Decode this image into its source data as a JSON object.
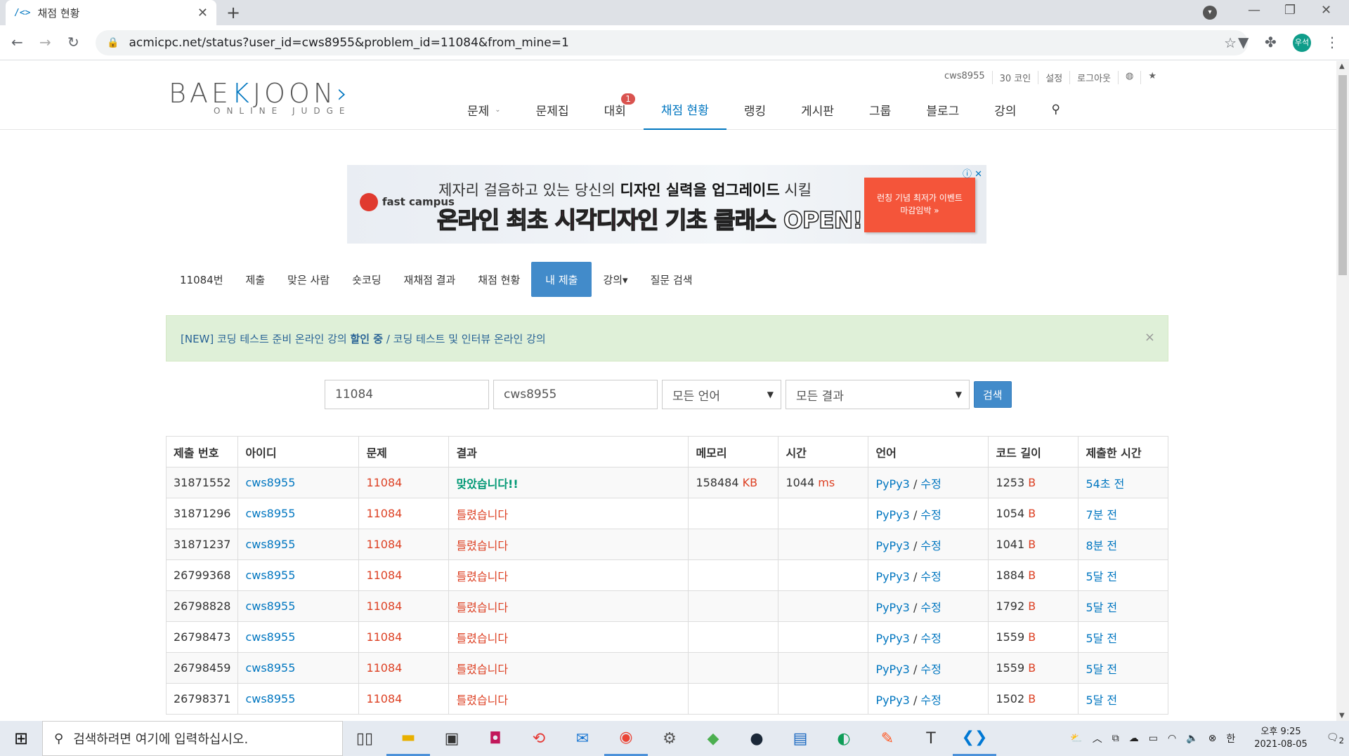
{
  "browser": {
    "tab_title": "채점 현황",
    "url": "acmicpc.net/status?user_id=cws8955&problem_id=11084&from_mine=1",
    "profile_label": "우석"
  },
  "site": {
    "logo_main": "BAE",
    "logo_k": "K",
    "logo_rest": "JOON",
    "logo_sub": "ONLINE JUDGE",
    "top_menu": [
      "cws8955",
      "30 코인",
      "설정",
      "로그아웃"
    ],
    "nav": [
      {
        "label": "문제",
        "caret": true
      },
      {
        "label": "문제집"
      },
      {
        "label": "대회",
        "badge": "1"
      },
      {
        "label": "채점 현황",
        "active": true
      },
      {
        "label": "랭킹"
      },
      {
        "label": "게시판"
      },
      {
        "label": "그룹"
      },
      {
        "label": "블로그"
      },
      {
        "label": "강의"
      }
    ]
  },
  "ad": {
    "brand": "fast campus",
    "line1_pre": "제자리 걸음하고 있는 당신의 ",
    "line1_bold": "디자인 실력을 업그레이드",
    "line1_post": " 시킬",
    "line2_pre": "온라인 최초 ",
    "line2_pink": "시각디자인",
    "line2_post": " 기초 클래스 OPEN!",
    "cta_line1": "런칭 기념 최저가 이벤트",
    "cta_line2": "마감임박 »"
  },
  "subnav": [
    "11084번",
    "제출",
    "맞은 사람",
    "숏코딩",
    "재채점 결과",
    "채점 현황",
    "내 제출",
    "강의▾",
    "질문 검색"
  ],
  "alert": {
    "text1": "[NEW] 코딩 테스트 준비 온라인 강의 ",
    "highlight": "할인 중",
    "text2": " / 코딩 테스트 및 인터뷰 온라인 강의"
  },
  "filters": {
    "problem_id": "11084",
    "user_id": "cws8955",
    "language": "모든 언어",
    "result": "모든 결과",
    "search_label": "검색"
  },
  "table": {
    "headers": [
      "제출 번호",
      "아이디",
      "문제",
      "결과",
      "메모리",
      "시간",
      "언어",
      "코드 길이",
      "제출한 시간"
    ],
    "rows": [
      {
        "id": "31871552",
        "user": "cws8955",
        "problem": "11084",
        "result": "맞았습니다!!",
        "ok": true,
        "memory": "158484",
        "memory_unit": "KB",
        "time": "1044",
        "time_unit": "ms",
        "lang": "PyPy3",
        "edit": "수정",
        "len": "1253",
        "len_unit": "B",
        "when": "54초 전"
      },
      {
        "id": "31871296",
        "user": "cws8955",
        "problem": "11084",
        "result": "틀렸습니다",
        "ok": false,
        "memory": "",
        "memory_unit": "",
        "time": "",
        "time_unit": "",
        "lang": "PyPy3",
        "edit": "수정",
        "len": "1054",
        "len_unit": "B",
        "when": "7분 전"
      },
      {
        "id": "31871237",
        "user": "cws8955",
        "problem": "11084",
        "result": "틀렸습니다",
        "ok": false,
        "memory": "",
        "memory_unit": "",
        "time": "",
        "time_unit": "",
        "lang": "PyPy3",
        "edit": "수정",
        "len": "1041",
        "len_unit": "B",
        "when": "8분 전"
      },
      {
        "id": "26799368",
        "user": "cws8955",
        "problem": "11084",
        "result": "틀렸습니다",
        "ok": false,
        "memory": "",
        "memory_unit": "",
        "time": "",
        "time_unit": "",
        "lang": "PyPy3",
        "edit": "수정",
        "len": "1884",
        "len_unit": "B",
        "when": "5달 전"
      },
      {
        "id": "26798828",
        "user": "cws8955",
        "problem": "11084",
        "result": "틀렸습니다",
        "ok": false,
        "memory": "",
        "memory_unit": "",
        "time": "",
        "time_unit": "",
        "lang": "PyPy3",
        "edit": "수정",
        "len": "1792",
        "len_unit": "B",
        "when": "5달 전"
      },
      {
        "id": "26798473",
        "user": "cws8955",
        "problem": "11084",
        "result": "틀렸습니다",
        "ok": false,
        "memory": "",
        "memory_unit": "",
        "time": "",
        "time_unit": "",
        "lang": "PyPy3",
        "edit": "수정",
        "len": "1559",
        "len_unit": "B",
        "when": "5달 전"
      },
      {
        "id": "26798459",
        "user": "cws8955",
        "problem": "11084",
        "result": "틀렸습니다",
        "ok": false,
        "memory": "",
        "memory_unit": "",
        "time": "",
        "time_unit": "",
        "lang": "PyPy3",
        "edit": "수정",
        "len": "1559",
        "len_unit": "B",
        "when": "5달 전"
      },
      {
        "id": "26798371",
        "user": "cws8955",
        "problem": "11084",
        "result": "틀렸습니다",
        "ok": false,
        "memory": "",
        "memory_unit": "",
        "time": "",
        "time_unit": "",
        "lang": "PyPy3",
        "edit": "수정",
        "len": "1502",
        "len_unit": "B",
        "when": "5달 전"
      }
    ]
  },
  "taskbar": {
    "search_placeholder": "검색하려면 여기에 입력하십시오.",
    "ime": "한",
    "time": "오후 9:25",
    "date": "2021-08-05",
    "notifications": "2"
  }
}
